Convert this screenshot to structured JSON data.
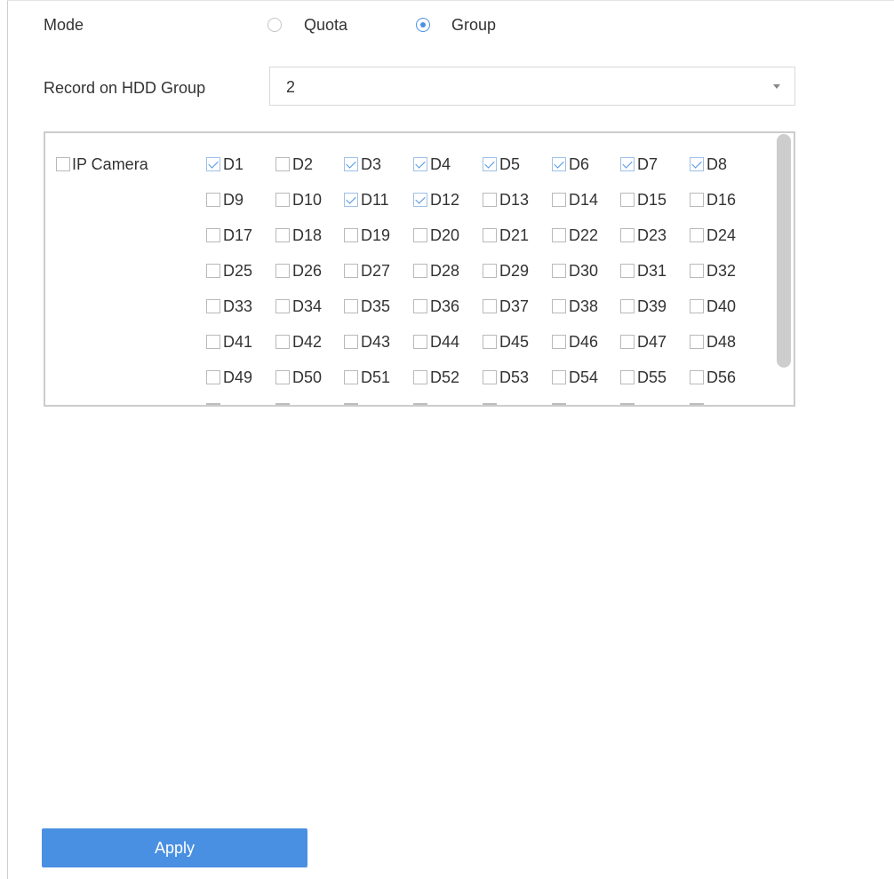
{
  "mode": {
    "label": "Mode",
    "options": [
      {
        "label": "Quota",
        "selected": false
      },
      {
        "label": "Group",
        "selected": true
      }
    ]
  },
  "hdd_group": {
    "label": "Record on HDD Group",
    "value": "2"
  },
  "channels": {
    "ip_camera_label": "IP Camera",
    "ip_camera_checked": false,
    "visible_rows": [
      [
        {
          "label": "D1",
          "checked": true
        },
        {
          "label": "D2",
          "checked": false
        },
        {
          "label": "D3",
          "checked": true
        },
        {
          "label": "D4",
          "checked": true
        },
        {
          "label": "D5",
          "checked": true
        },
        {
          "label": "D6",
          "checked": true
        },
        {
          "label": "D7",
          "checked": true
        },
        {
          "label": "D8",
          "checked": true
        }
      ],
      [
        {
          "label": "D9",
          "checked": false
        },
        {
          "label": "D10",
          "checked": false
        },
        {
          "label": "D11",
          "checked": true
        },
        {
          "label": "D12",
          "checked": true
        },
        {
          "label": "D13",
          "checked": false
        },
        {
          "label": "D14",
          "checked": false
        },
        {
          "label": "D15",
          "checked": false
        },
        {
          "label": "D16",
          "checked": false
        }
      ],
      [
        {
          "label": "D17",
          "checked": false
        },
        {
          "label": "D18",
          "checked": false
        },
        {
          "label": "D19",
          "checked": false
        },
        {
          "label": "D20",
          "checked": false
        },
        {
          "label": "D21",
          "checked": false
        },
        {
          "label": "D22",
          "checked": false
        },
        {
          "label": "D23",
          "checked": false
        },
        {
          "label": "D24",
          "checked": false
        }
      ],
      [
        {
          "label": "D25",
          "checked": false
        },
        {
          "label": "D26",
          "checked": false
        },
        {
          "label": "D27",
          "checked": false
        },
        {
          "label": "D28",
          "checked": false
        },
        {
          "label": "D29",
          "checked": false
        },
        {
          "label": "D30",
          "checked": false
        },
        {
          "label": "D31",
          "checked": false
        },
        {
          "label": "D32",
          "checked": false
        }
      ],
      [
        {
          "label": "D33",
          "checked": false
        },
        {
          "label": "D34",
          "checked": false
        },
        {
          "label": "D35",
          "checked": false
        },
        {
          "label": "D36",
          "checked": false
        },
        {
          "label": "D37",
          "checked": false
        },
        {
          "label": "D38",
          "checked": false
        },
        {
          "label": "D39",
          "checked": false
        },
        {
          "label": "D40",
          "checked": false
        }
      ],
      [
        {
          "label": "D41",
          "checked": false
        },
        {
          "label": "D42",
          "checked": false
        },
        {
          "label": "D43",
          "checked": false
        },
        {
          "label": "D44",
          "checked": false
        },
        {
          "label": "D45",
          "checked": false
        },
        {
          "label": "D46",
          "checked": false
        },
        {
          "label": "D47",
          "checked": false
        },
        {
          "label": "D48",
          "checked": false
        }
      ],
      [
        {
          "label": "D49",
          "checked": false
        },
        {
          "label": "D50",
          "checked": false
        },
        {
          "label": "D51",
          "checked": false
        },
        {
          "label": "D52",
          "checked": false
        },
        {
          "label": "D53",
          "checked": false
        },
        {
          "label": "D54",
          "checked": false
        },
        {
          "label": "D55",
          "checked": false
        },
        {
          "label": "D56",
          "checked": false
        }
      ]
    ]
  },
  "apply_label": "Apply",
  "colors": {
    "accent": "#4a90e2",
    "text": "#333333",
    "border": "#cccccc"
  }
}
